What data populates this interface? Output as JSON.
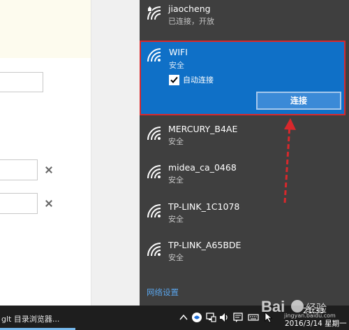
{
  "networks": [
    {
      "name": "jiaocheng",
      "status": "已连接，开放"
    },
    {
      "name": "WIFI",
      "status": "安全"
    },
    {
      "name": "MERCURY_B4AE",
      "status": "安全"
    },
    {
      "name": "midea_ca_0468",
      "status": "安全"
    },
    {
      "name": "TP-LINK_1C1078",
      "status": "安全"
    },
    {
      "name": "TP-LINK_A65BDE",
      "status": "安全"
    }
  ],
  "selected": {
    "auto_connect_label": "自动连接",
    "auto_connect_checked": true,
    "connect_button": "连接"
  },
  "network_settings": "网络设置",
  "taskbar": {
    "window_title": "glt 目录浏览器...",
    "time": "21:33",
    "date": "2016/3/14 星期一"
  },
  "watermark": {
    "brand": "Bai度 经验",
    "url": "jingyan.baidu.com"
  },
  "colors": {
    "flyout_bg": "#3f3f3f",
    "selected_bg": "#0f70c7",
    "highlight_border": "#d8282c",
    "taskbar": "#1e1e1e",
    "link": "#5aa3e8"
  }
}
